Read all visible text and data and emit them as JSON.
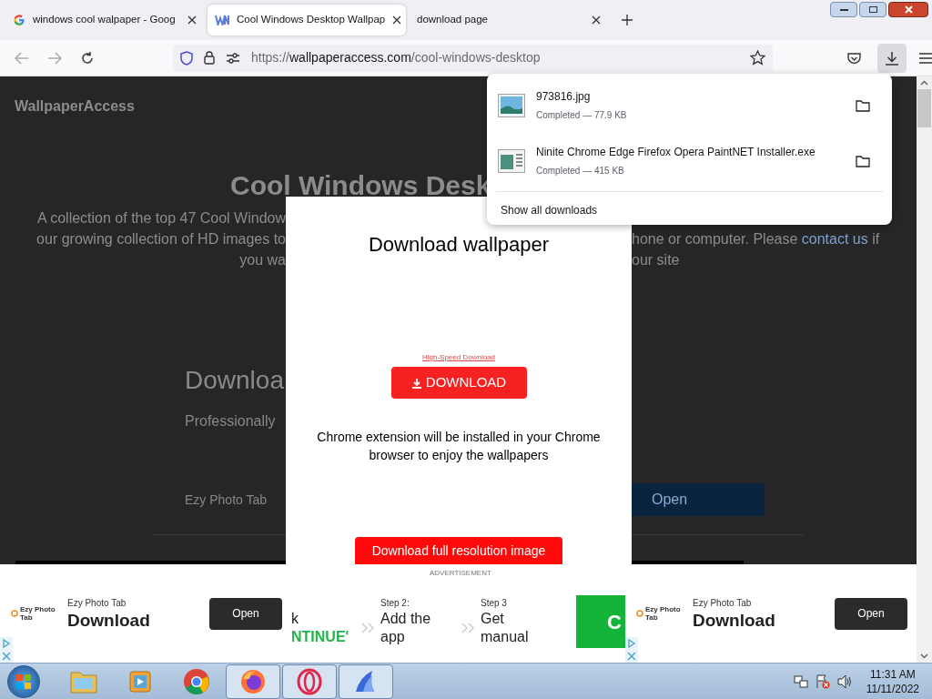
{
  "browser": {
    "tabs": [
      {
        "kind": "search",
        "title": "windows cool walpaper - Goog",
        "selected": false
      },
      {
        "kind": "site",
        "title": "Cool Windows Desktop Wallpap",
        "selected": true
      },
      {
        "kind": "blank",
        "title": "download page",
        "selected": false
      }
    ],
    "url": {
      "scheme": "https://",
      "host": "wallpaperaccess.com",
      "path": "/cool-windows-desktop"
    }
  },
  "page": {
    "logo": "WallpaperAccess",
    "heading": "Cool Windows Desk",
    "intro_left": [
      "A collection of the top 47 Cool Window",
      "our growing collection of HD images to",
      "you wa"
    ],
    "intro_right": [
      "hone or computer. Please",
      "our site"
    ],
    "intro_link": "contact us",
    "intro_tail": "if",
    "section_heading": "Downloa",
    "section_sub": "Professionally",
    "ad_name": "Ezy Photo Tab",
    "ad_button": "Open"
  },
  "modal": {
    "title": "Download wallpaper",
    "ad_label": "High-Speed Download",
    "ad_button": "DOWNLOAD",
    "note": "Chrome extension will be installed in your Chrome browser to enjoy the wallpapers",
    "main_button": "Download full resolution image"
  },
  "downloads": {
    "items": [
      {
        "kind": "image",
        "name": "973816.jpg",
        "status": "Completed — 77.9 KB"
      },
      {
        "kind": "program",
        "name": "Ninite Chrome Edge Firefox Opera PaintNET Installer.exe",
        "status": "Completed — 415 KB"
      }
    ],
    "show_all": "Show all downloads"
  },
  "ads": {
    "label": "ADVERTISEMENT",
    "banners": [
      {
        "logo": "Ezy Photo Tab",
        "brand": "Ezy Photo Tab",
        "title": "Download",
        "button": "Open"
      },
      {
        "logo": "Ezy Photo Tab",
        "brand": "Ezy Photo Tab",
        "title": "Download",
        "button": "Open"
      }
    ],
    "middle": {
      "step1_tail": "k",
      "step1_action": "NTINUE'",
      "steps": [
        {
          "label": "Step 2:",
          "text": "Add the app"
        },
        {
          "label": "Step 3",
          "text": "Get manual"
        }
      ],
      "button": "C"
    }
  },
  "taskbar": {
    "apps": [
      {
        "kind": "folder",
        "running": false
      },
      {
        "kind": "media",
        "running": false
      },
      {
        "kind": "chrome",
        "running": false
      },
      {
        "kind": "firefox",
        "running": true
      },
      {
        "kind": "opera",
        "running": true
      },
      {
        "kind": "shark",
        "running": true
      }
    ],
    "time": "11:31 AM",
    "date": "11/11/2022"
  }
}
